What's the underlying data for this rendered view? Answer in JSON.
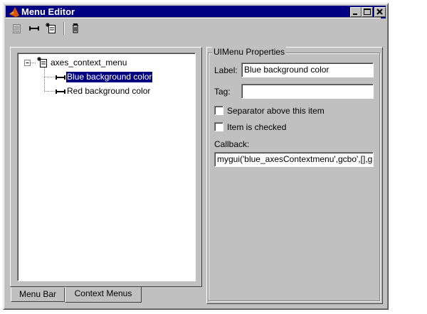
{
  "window": {
    "title": "Menu Editor"
  },
  "toolbar": {
    "new_menu_icon": "new-menu-icon",
    "new_menu_item_icon": "new-menu-item-icon",
    "new_context_menu_icon": "new-context-menu-icon",
    "delete_icon": "delete-icon"
  },
  "tree": {
    "root": "axes_context_menu",
    "items": [
      "Blue background color",
      "Red background color"
    ],
    "selected_index": 0
  },
  "tabs": [
    {
      "label": "Menu Bar"
    },
    {
      "label": "Context Menus"
    }
  ],
  "properties": {
    "group_title": "UIMenu Properties",
    "label_caption": "Label:",
    "label_value": "Blue background color",
    "tag_caption": "Tag:",
    "tag_value": "",
    "separator_caption": "Separator above this item",
    "checked_caption": "Item is checked",
    "callback_caption": "Callback:",
    "callback_value": "mygui('blue_axesContextmenu',gcbo',[],g"
  }
}
